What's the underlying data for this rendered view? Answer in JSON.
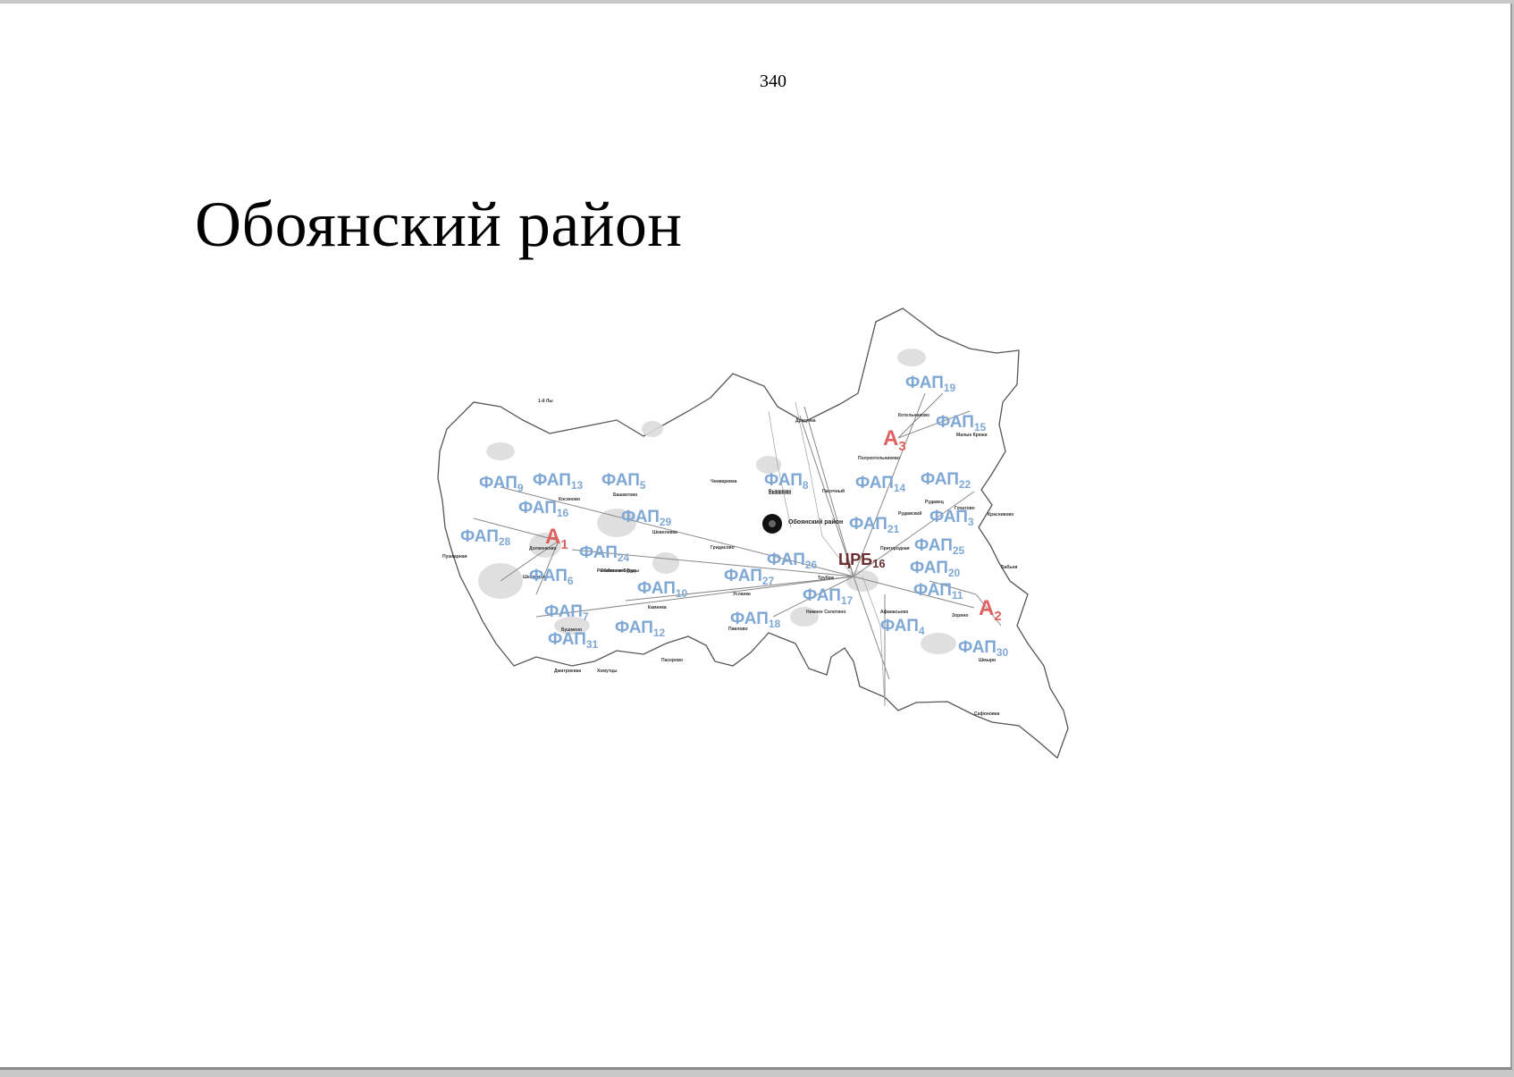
{
  "page": {
    "number": "340",
    "title": "Обоянский район"
  },
  "map": {
    "center_label": "Обоянский район",
    "crb": {
      "label": "ЦРБ",
      "sub": "16"
    },
    "ambulatories": [
      {
        "label": "А",
        "sub": "1"
      },
      {
        "label": "А",
        "sub": "2"
      },
      {
        "label": "А",
        "sub": "3"
      }
    ],
    "faps": [
      {
        "label": "ФАП",
        "sub": "19"
      },
      {
        "label": "ФАП",
        "sub": "15"
      },
      {
        "label": "ФАП",
        "sub": "9"
      },
      {
        "label": "ФАП",
        "sub": "13"
      },
      {
        "label": "ФАП",
        "sub": "5"
      },
      {
        "label": "ФАП",
        "sub": "8"
      },
      {
        "label": "ФАП",
        "sub": "14"
      },
      {
        "label": "ФАП",
        "sub": "22"
      },
      {
        "label": "ФАП",
        "sub": "16"
      },
      {
        "label": "ФАП",
        "sub": "29"
      },
      {
        "label": "ФАП",
        "sub": "21"
      },
      {
        "label": "ФАП",
        "sub": "3"
      },
      {
        "label": "ФАП",
        "sub": "28"
      },
      {
        "label": "ФАП",
        "sub": "24"
      },
      {
        "label": "ФАП",
        "sub": "26"
      },
      {
        "label": "ФАП",
        "sub": "25"
      },
      {
        "label": "ФАП",
        "sub": "6"
      },
      {
        "label": "ФАП",
        "sub": "27"
      },
      {
        "label": "ФАП",
        "sub": "10"
      },
      {
        "label": "ФАП",
        "sub": "20"
      },
      {
        "label": "ФАП",
        "sub": "11"
      },
      {
        "label": "ФАП",
        "sub": "17"
      },
      {
        "label": "ФАП",
        "sub": "7"
      },
      {
        "label": "ФАП",
        "sub": "18"
      },
      {
        "label": "ФАП",
        "sub": "4"
      },
      {
        "label": "ФАП",
        "sub": "12"
      },
      {
        "label": "ФАП",
        "sub": "31"
      },
      {
        "label": "ФАП",
        "sub": "30"
      }
    ],
    "villages": [
      "Рыбинские Буды",
      "Бушмено",
      "Павлово",
      "Усланка",
      "Каменка",
      "Афанасьево",
      "Зорино",
      "Шевелевка",
      "Гридасово",
      "Рудавский",
      "Полукотельниково",
      "Котельниково",
      "Малые Крюки",
      "Бабьня",
      "Сафоновка",
      "Шмыри",
      "Пасечный",
      "Быканово",
      "Башкатово",
      "Долженково",
      "Рыбинские Буды",
      "Косиново",
      "Нижнее Солотино",
      "Гочатово",
      "Драгунка",
      "Дмитриевка",
      "Хомутцы",
      "Пасерово",
      "Шевякинка",
      "Чекмаревка",
      "Рудавец",
      "Красниково",
      "Трубеж",
      "Пригородная",
      "Быканово",
      "1-й Лы",
      "Пушкарная"
    ]
  }
}
